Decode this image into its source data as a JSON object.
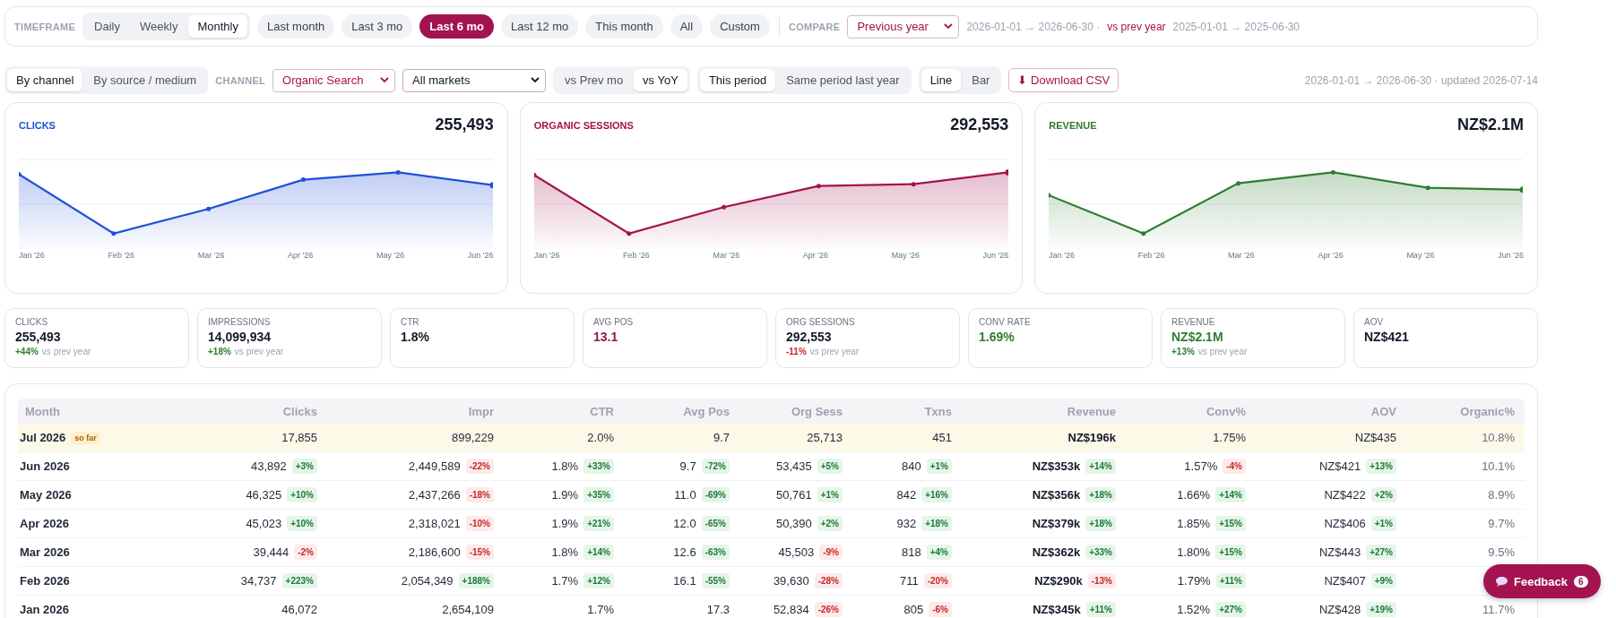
{
  "timeframe": {
    "label": "TIMEFRAME",
    "granularity": [
      {
        "label": "Daily",
        "selected": false
      },
      {
        "label": "Weekly",
        "selected": false
      },
      {
        "label": "Monthly",
        "selected": true
      }
    ],
    "ranges": [
      {
        "label": "Last month",
        "selected": false
      },
      {
        "label": "Last 3 mo",
        "selected": false
      },
      {
        "label": "Last 6 mo",
        "selected": true
      },
      {
        "label": "Last 12 mo",
        "selected": false
      },
      {
        "label": "This month",
        "selected": false
      },
      {
        "label": "All",
        "selected": false
      },
      {
        "label": "Custom",
        "selected": false
      }
    ],
    "compare_label": "COMPARE",
    "compare_value": "Previous year",
    "current_range": "2026-01-01 → 2026-06-30 ·",
    "compare_text": "vs prev year",
    "compare_range": "2025-01-01 → 2025-06-30"
  },
  "filters": {
    "breakdown": [
      {
        "label": "By channel",
        "selected": true
      },
      {
        "label": "By source / medium",
        "selected": false
      }
    ],
    "channel_label": "CHANNEL",
    "channel_value": "Organic Search",
    "market_value": "All markets",
    "comparison": [
      {
        "label": "vs Prev mo",
        "selected": false
      },
      {
        "label": "vs YoY",
        "selected": true
      }
    ],
    "period": [
      {
        "label": "This period",
        "selected": true
      },
      {
        "label": "Same period last year",
        "selected": false
      }
    ],
    "chart_type": [
      {
        "label": "Line",
        "selected": true
      },
      {
        "label": "Bar",
        "selected": false
      }
    ],
    "download": "⬇ Download CSV",
    "status": "2026-01-01 → 2026-06-30 · updated 2026-07-14"
  },
  "charts": [
    {
      "title": "CLICKS",
      "value": "255,493",
      "color": "#1f4fd8",
      "x_labels": [
        "Jan '26",
        "Feb '26",
        "Mar '26",
        "Apr '26",
        "May '26",
        "Jun '26"
      ]
    },
    {
      "title": "ORGANIC SESSIONS",
      "value": "292,553",
      "color": "#a3134f",
      "x_labels": [
        "Jan '26",
        "Feb '26",
        "Mar '26",
        "Apr '26",
        "May '26",
        "Jun '26"
      ]
    },
    {
      "title": "REVENUE",
      "value": "NZ$2.1M",
      "color": "#2e7d32",
      "x_labels": [
        "Jan '26",
        "Feb '26",
        "Mar '26",
        "Apr '26",
        "May '26",
        "Jun '26"
      ]
    }
  ],
  "kpis": [
    {
      "label": "CLICKS",
      "value": "255,493",
      "color": "#111827",
      "delta": {
        "text": "+44%",
        "color": "#2e7d32"
      },
      "note": "vs prev year"
    },
    {
      "label": "IMPRESSIONS",
      "value": "14,099,934",
      "color": "#111827",
      "delta": {
        "text": "+18%",
        "color": "#2e7d32"
      },
      "note": "vs prev year"
    },
    {
      "label": "CTR",
      "value": "1.8%",
      "color": "#111827"
    },
    {
      "label": "AVG POS",
      "value": "13.1",
      "color": "#8a1a4a"
    },
    {
      "label": "ORG SESSIONS",
      "value": "292,553",
      "color": "#111827",
      "delta": {
        "text": "-11%",
        "color": "#c62828"
      },
      "note": "vs prev year"
    },
    {
      "label": "CONV RATE",
      "value": "1.69%",
      "color": "#2e7d32"
    },
    {
      "label": "REVENUE",
      "value": "NZ$2.1M",
      "color": "#2e7d32",
      "delta": {
        "text": "+13%",
        "color": "#2e7d32"
      },
      "note": "vs prev year"
    },
    {
      "label": "AOV",
      "value": "NZ$421",
      "color": "#111827"
    }
  ],
  "table": {
    "columns": [
      "Month",
      "Clicks",
      "Impr",
      "CTR",
      "Avg Pos",
      "Org Sess",
      "Txns",
      "Revenue",
      "Conv%",
      "AOV",
      "Organic%"
    ],
    "rows": [
      {
        "highlighted": true,
        "cells": [
          {
            "value": "Jul 2026",
            "badge": "so far"
          },
          {
            "value": "17,855"
          },
          {
            "value": "899,229"
          },
          {
            "value": "2.0%"
          },
          {
            "value": "9.7"
          },
          {
            "value": "25,713"
          },
          {
            "value": "451"
          },
          {
            "value": "NZ$196k"
          },
          {
            "value": "1.75%"
          },
          {
            "value": "NZ$435"
          },
          {
            "value": "10.8%"
          }
        ]
      },
      {
        "highlighted": false,
        "cells": [
          {
            "value": "Jun 2026"
          },
          {
            "value": "43,892",
            "change": "+3%",
            "good": true
          },
          {
            "value": "2,449,589",
            "change": "-22%",
            "good": false
          },
          {
            "value": "1.8%",
            "change": "+33%",
            "good": true
          },
          {
            "value": "9.7",
            "change": "-72%",
            "good": true
          },
          {
            "value": "53,435",
            "change": "+5%",
            "good": true
          },
          {
            "value": "840",
            "change": "+1%",
            "good": true
          },
          {
            "value": "NZ$353k",
            "change": "+14%",
            "good": true
          },
          {
            "value": "1.57%",
            "change": "-4%",
            "good": false
          },
          {
            "value": "NZ$421",
            "change": "+13%",
            "good": true
          },
          {
            "value": "10.1%"
          }
        ]
      },
      {
        "highlighted": false,
        "cells": [
          {
            "value": "May 2026"
          },
          {
            "value": "46,325",
            "change": "+10%",
            "good": true
          },
          {
            "value": "2,437,266",
            "change": "-18%",
            "good": false
          },
          {
            "value": "1.9%",
            "change": "+35%",
            "good": true
          },
          {
            "value": "11.0",
            "change": "-69%",
            "good": true
          },
          {
            "value": "50,761",
            "change": "+1%",
            "good": true
          },
          {
            "value": "842",
            "change": "+16%",
            "good": true
          },
          {
            "value": "NZ$356k",
            "change": "+18%",
            "good": true
          },
          {
            "value": "1.66%",
            "change": "+14%",
            "good": true
          },
          {
            "value": "NZ$422",
            "change": "+2%",
            "good": true
          },
          {
            "value": "8.9%"
          }
        ]
      },
      {
        "highlighted": false,
        "cells": [
          {
            "value": "Apr 2026"
          },
          {
            "value": "45,023",
            "change": "+10%",
            "good": true
          },
          {
            "value": "2,318,021",
            "change": "-10%",
            "good": false
          },
          {
            "value": "1.9%",
            "change": "+21%",
            "good": true
          },
          {
            "value": "12.0",
            "change": "-65%",
            "good": true
          },
          {
            "value": "50,390",
            "change": "+2%",
            "good": true
          },
          {
            "value": "932",
            "change": "+18%",
            "good": true
          },
          {
            "value": "NZ$379k",
            "change": "+18%",
            "good": true
          },
          {
            "value": "1.85%",
            "change": "+15%",
            "good": true
          },
          {
            "value": "NZ$406",
            "change": "+1%",
            "good": true
          },
          {
            "value": "9.7%"
          }
        ]
      },
      {
        "highlighted": false,
        "cells": [
          {
            "value": "Mar 2026"
          },
          {
            "value": "39,444",
            "change": "-2%",
            "good": false
          },
          {
            "value": "2,186,600",
            "change": "-15%",
            "good": false
          },
          {
            "value": "1.8%",
            "change": "+14%",
            "good": true
          },
          {
            "value": "12.6",
            "change": "-63%",
            "good": true
          },
          {
            "value": "45,503",
            "change": "-9%",
            "good": false
          },
          {
            "value": "818",
            "change": "+4%",
            "good": true
          },
          {
            "value": "NZ$362k",
            "change": "+33%",
            "good": true
          },
          {
            "value": "1.80%",
            "change": "+15%",
            "good": true
          },
          {
            "value": "NZ$443",
            "change": "+27%",
            "good": true
          },
          {
            "value": "9.5%"
          }
        ]
      },
      {
        "highlighted": false,
        "cells": [
          {
            "value": "Feb 2026"
          },
          {
            "value": "34,737",
            "change": "+223%",
            "good": true
          },
          {
            "value": "2,054,349",
            "change": "+188%",
            "good": true
          },
          {
            "value": "1.7%",
            "change": "+12%",
            "good": true
          },
          {
            "value": "16.1",
            "change": "-55%",
            "good": true
          },
          {
            "value": "39,630",
            "change": "-28%",
            "good": false
          },
          {
            "value": "711",
            "change": "-20%",
            "good": false
          },
          {
            "value": "NZ$290k",
            "change": "-13%",
            "good": false
          },
          {
            "value": "1.79%",
            "change": "+11%",
            "good": true
          },
          {
            "value": "NZ$407",
            "change": "+9%",
            "good": true
          },
          {}
        ]
      },
      {
        "highlighted": false,
        "cells": [
          {
            "value": "Jan 2026"
          },
          {
            "value": "46,072"
          },
          {
            "value": "2,654,109"
          },
          {
            "value": "1.7%"
          },
          {
            "value": "17.3"
          },
          {
            "value": "52,834",
            "change": "-26%",
            "good": false
          },
          {
            "value": "805",
            "change": "-6%",
            "good": false
          },
          {
            "value": "NZ$345k",
            "change": "+11%",
            "good": true
          },
          {
            "value": "1.52%",
            "change": "+27%",
            "good": true
          },
          {
            "value": "NZ$428",
            "change": "+19%",
            "good": true
          },
          {
            "value": "11.7%"
          }
        ]
      }
    ]
  },
  "feedback": {
    "label": "Feedback",
    "count": "6"
  }
}
